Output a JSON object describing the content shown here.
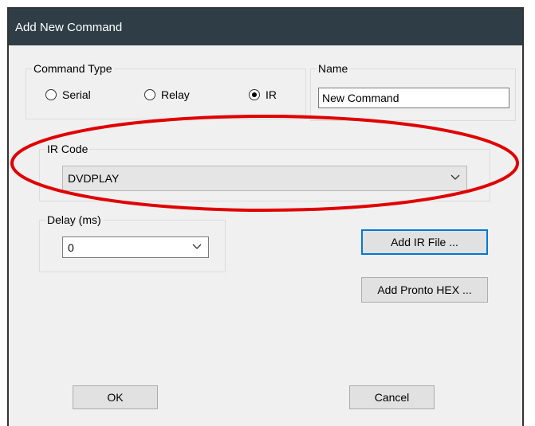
{
  "window": {
    "title": "Add New Command"
  },
  "command_type": {
    "label": "Command Type",
    "options": [
      {
        "label": "Serial",
        "checked": false
      },
      {
        "label": "Relay",
        "checked": false
      },
      {
        "label": "IR",
        "checked": true
      }
    ]
  },
  "name": {
    "label": "Name",
    "value": "New Command"
  },
  "ir_code": {
    "label": "IR Code",
    "selected": "DVDPLAY"
  },
  "delay": {
    "label": "Delay (ms)",
    "selected": "0"
  },
  "buttons": {
    "add_ir_file": "Add IR File ...",
    "add_pronto_hex": "Add Pronto HEX ...",
    "ok": "OK",
    "cancel": "Cancel"
  },
  "annotation": {
    "color": "#e00000",
    "shape": "ellipse"
  }
}
